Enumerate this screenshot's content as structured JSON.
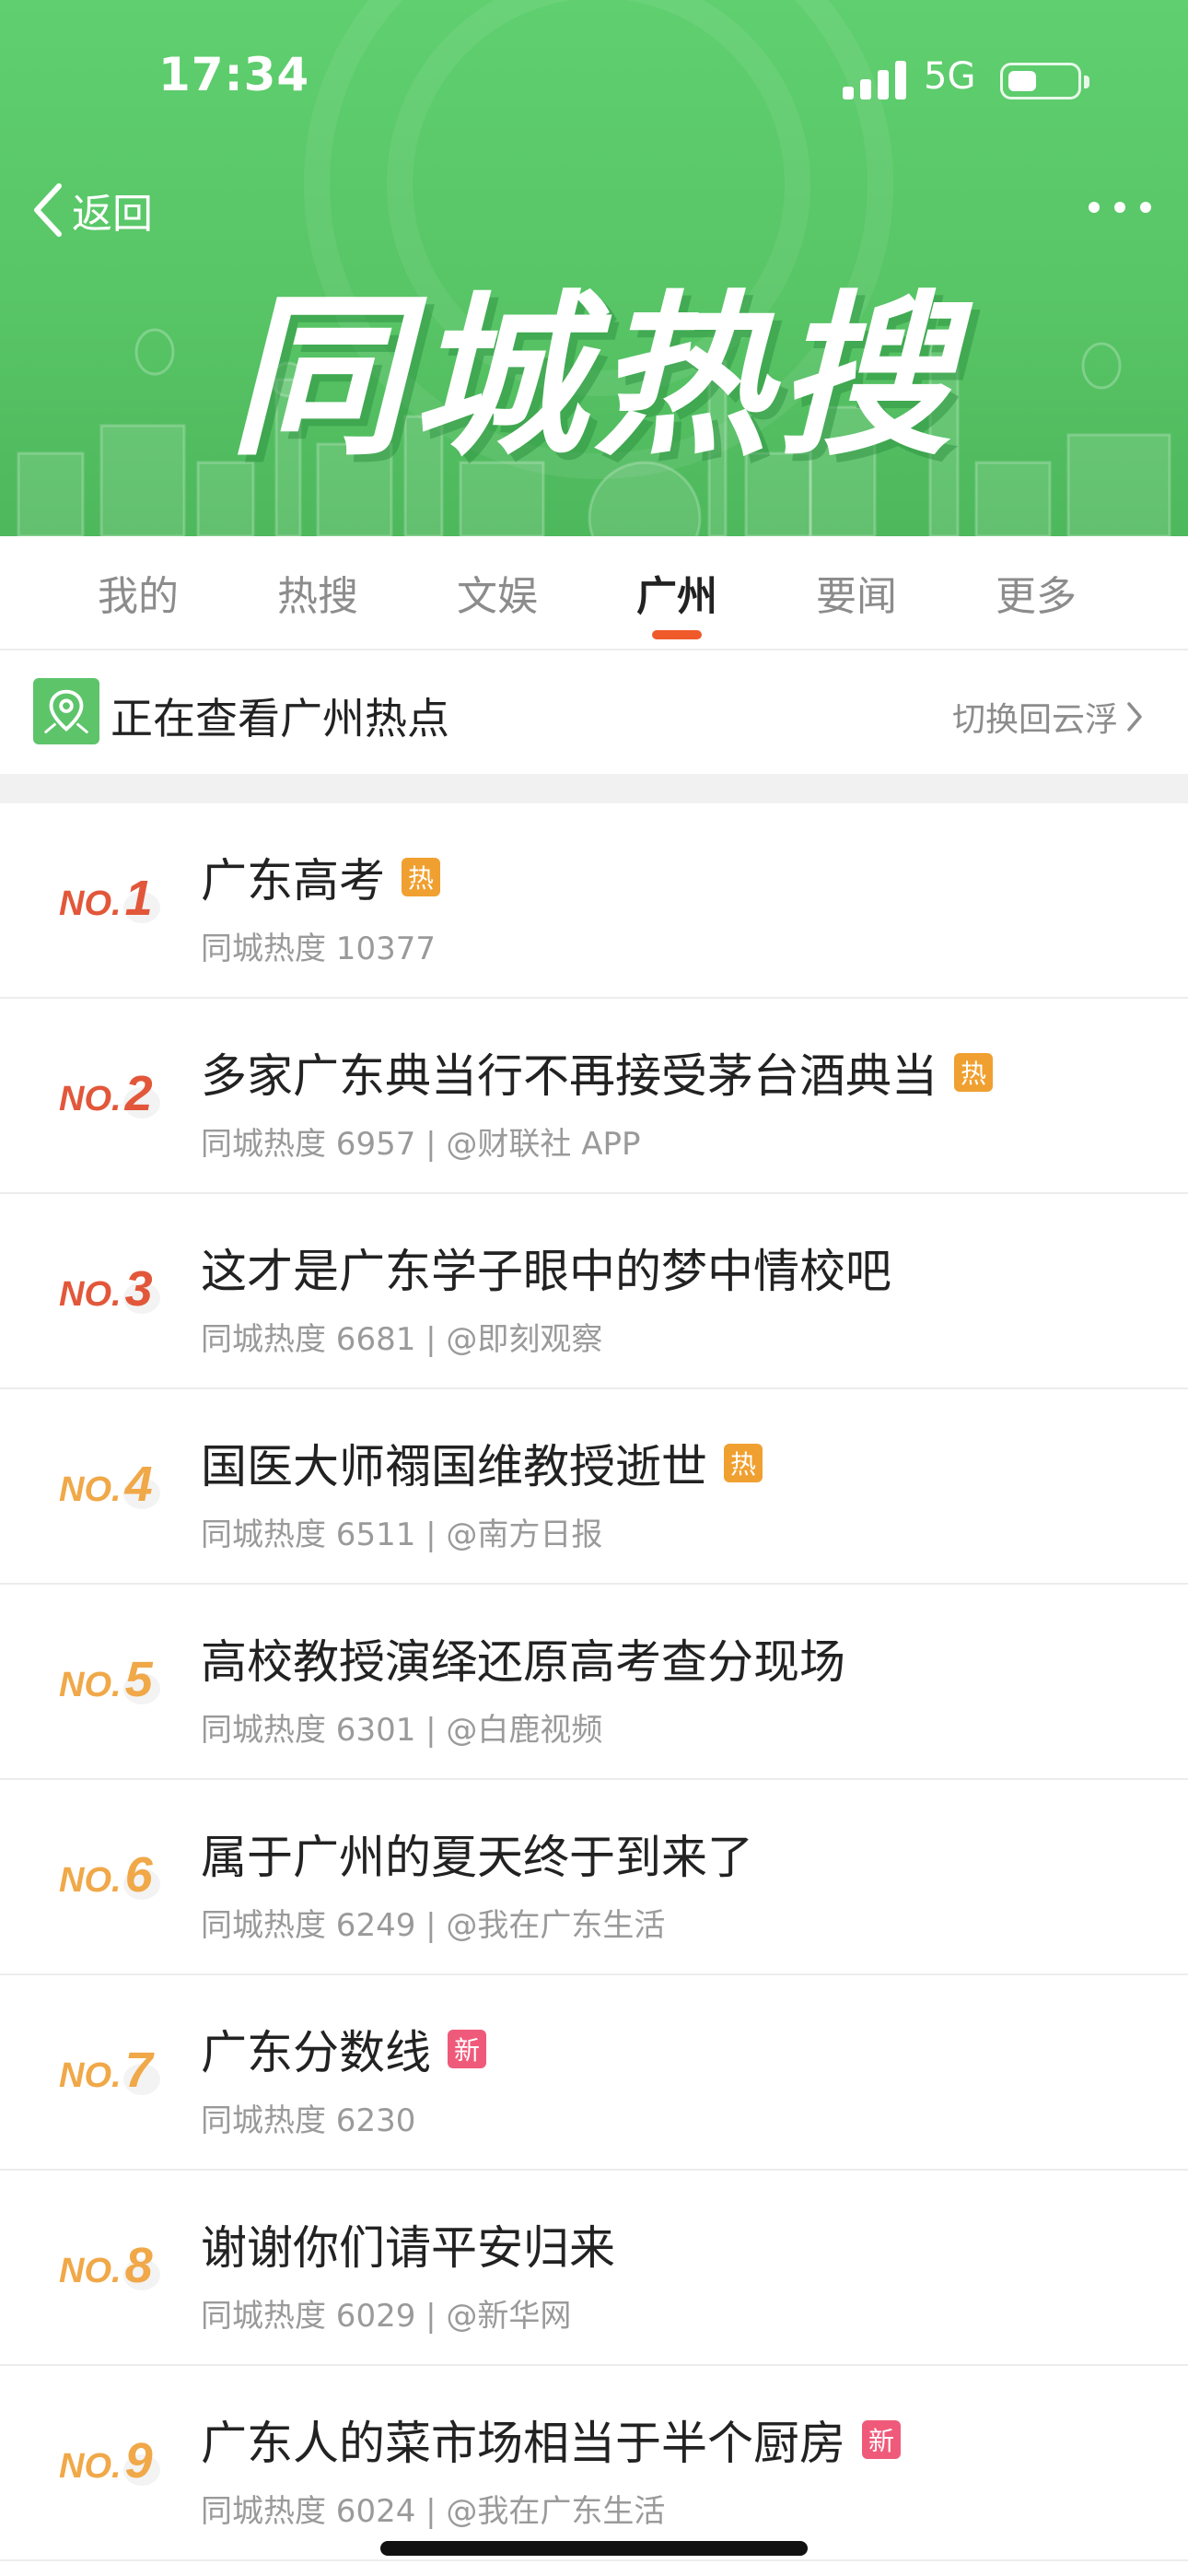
{
  "status_bar": {
    "time": "17:34",
    "network": "5G"
  },
  "header": {
    "back_label": "返回",
    "banner_title": "同城热搜"
  },
  "tabs": [
    {
      "label": "我的",
      "active": false
    },
    {
      "label": "热搜",
      "active": false
    },
    {
      "label": "文娱",
      "active": false
    },
    {
      "label": "广州",
      "active": true
    },
    {
      "label": "要闻",
      "active": false
    },
    {
      "label": "更多",
      "active": false
    }
  ],
  "location": {
    "text": "正在查看广州热点",
    "switch_label": "切换回云浮"
  },
  "colors": {
    "brand_green": "#5dc46a",
    "tab_accent": "#f05a2a",
    "tag_hot": "#f0a030",
    "tag_new": "#f05a7a"
  },
  "trending": [
    {
      "no": "NO.",
      "rank": "1",
      "title": "广东高考",
      "tag": "热",
      "tag_type": "hot",
      "meta": "同城热度 10377",
      "color": "#e2573a"
    },
    {
      "no": "NO.",
      "rank": "2",
      "title": "多家广东典当行不再接受茅台酒典当",
      "tag": "热",
      "tag_type": "hot",
      "meta": "同城热度 6957 | @财联社 APP",
      "color": "#e2573a"
    },
    {
      "no": "NO.",
      "rank": "3",
      "title": "这才是广东学子眼中的梦中情校吧",
      "tag": "",
      "tag_type": "",
      "meta": "同城热度 6681 | @即刻观察",
      "color": "#e2573a"
    },
    {
      "no": "NO.",
      "rank": "4",
      "title": "国医大师禤国维教授逝世",
      "tag": "热",
      "tag_type": "hot",
      "meta": "同城热度 6511 | @南方日报",
      "color": "#f0a848"
    },
    {
      "no": "NO.",
      "rank": "5",
      "title": "高校教授演绎还原高考查分现场",
      "tag": "",
      "tag_type": "",
      "meta": "同城热度 6301 | @白鹿视频",
      "color": "#f0a848"
    },
    {
      "no": "NO.",
      "rank": "6",
      "title": "属于广州的夏天终于到来了",
      "tag": "",
      "tag_type": "",
      "meta": "同城热度 6249 | @我在广东生活",
      "color": "#f0a848"
    },
    {
      "no": "NO.",
      "rank": "7",
      "title": "广东分数线",
      "tag": "新",
      "tag_type": "new",
      "meta": "同城热度 6230",
      "color": "#f0a848"
    },
    {
      "no": "NO.",
      "rank": "8",
      "title": "谢谢你们请平安归来",
      "tag": "",
      "tag_type": "",
      "meta": "同城热度 6029 | @新华网",
      "color": "#f0a848"
    },
    {
      "no": "NO.",
      "rank": "9",
      "title": "广东人的菜市场相当于半个厨房",
      "tag": "新",
      "tag_type": "new",
      "meta": "同城热度 6024 | @我在广东生活",
      "color": "#f0a848"
    }
  ]
}
